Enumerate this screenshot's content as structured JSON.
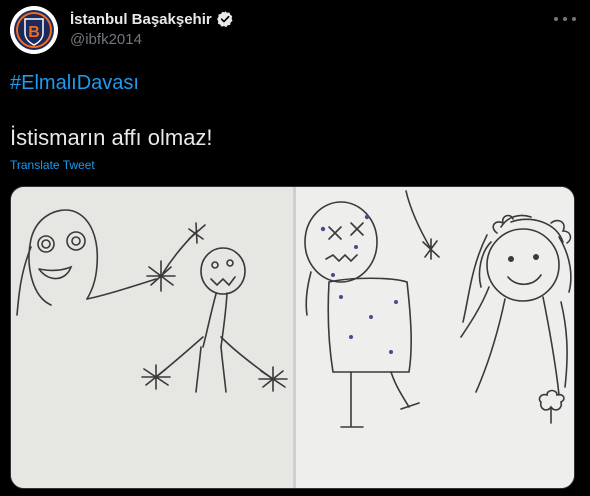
{
  "account": {
    "name": "İstanbul Başakşehir",
    "handle": "@ibfk2014",
    "avatar_logo_letter": "B",
    "verified_icon": "verified-badge-icon"
  },
  "tweet": {
    "hashtag": "#ElmalıDavası",
    "text": "İstismarın affı olmaz!",
    "translate_label": "Translate Tweet"
  },
  "icons": {
    "more": "more-options-icon"
  },
  "colors": {
    "background": "#000000",
    "accent": "#1d9bf0",
    "primary_text": "#e7e9ea",
    "secondary_text": "#71767b",
    "logo_navy": "#1b2a5a",
    "logo_orange": "#f26b21"
  }
}
